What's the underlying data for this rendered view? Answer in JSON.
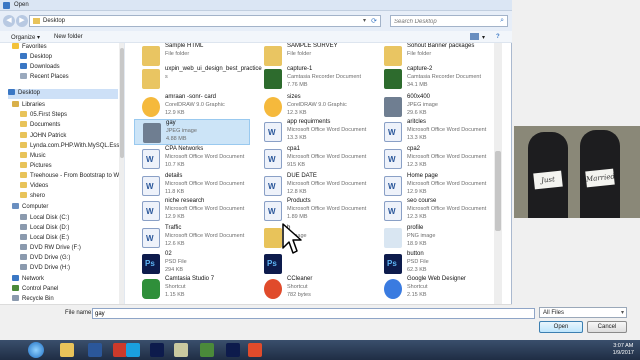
{
  "window": {
    "title": "Open"
  },
  "address": {
    "breadcrumb": "Desktop",
    "search_placeholder": "Search Desktop"
  },
  "toolbar": {
    "organize": "Organize ▾",
    "new_folder": "New folder"
  },
  "sidebar": {
    "items": [
      {
        "label": "Favorites",
        "icon": "star-icon"
      },
      {
        "label": "Desktop",
        "icon": "desktop-icon"
      },
      {
        "label": "Downloads",
        "icon": "downloads-icon"
      },
      {
        "label": "Recent Places",
        "icon": "recent-icon"
      },
      {
        "label": "Desktop",
        "icon": "desktop-icon",
        "selected": true
      },
      {
        "label": "Libraries",
        "icon": "libraries-icon"
      },
      {
        "label": "05.First Steps",
        "icon": "folder-icon"
      },
      {
        "label": "Documents",
        "icon": "documents-icon"
      },
      {
        "label": "JOHN Patrick",
        "icon": "folder-icon"
      },
      {
        "label": "Lynda.com.PHP.With.MySQL.Essent",
        "icon": "folder-icon"
      },
      {
        "label": "Music",
        "icon": "music-icon"
      },
      {
        "label": "Pictures",
        "icon": "pictures-icon"
      },
      {
        "label": "Treehouse - From Bootstrap to Word",
        "icon": "folder-icon"
      },
      {
        "label": "Videos",
        "icon": "videos-icon"
      },
      {
        "label": "shero",
        "icon": "user-icon"
      },
      {
        "label": "Computer",
        "icon": "computer-icon"
      },
      {
        "label": "Local Disk (C:)",
        "icon": "drive-icon"
      },
      {
        "label": "Local Disk (D:)",
        "icon": "drive-icon"
      },
      {
        "label": "Local Disk (E:)",
        "icon": "drive-icon"
      },
      {
        "label": "DVD RW Drive (F:)",
        "icon": "dvd-icon"
      },
      {
        "label": "DVD Drive (G:)",
        "icon": "dvd-icon"
      },
      {
        "label": "DVD Drive (H:)",
        "icon": "dvd-icon"
      },
      {
        "label": "Network",
        "icon": "network-icon"
      },
      {
        "label": "Control Panel",
        "icon": "control-panel-icon"
      },
      {
        "label": "Recycle Bin",
        "icon": "recycle-bin-icon"
      }
    ]
  },
  "files": [
    {
      "name": "Sample HTML",
      "type": "File folder",
      "size": "",
      "icon": "folder"
    },
    {
      "name": "SAMPLE SURVEY",
      "type": "File folder",
      "size": "",
      "icon": "folder"
    },
    {
      "name": "Sohout Banner packages",
      "type": "File folder",
      "size": "",
      "icon": "folder"
    },
    {
      "name": "uxpin_web_ui_design_best_practice",
      "type": "s",
      "size": "",
      "icon": "folder"
    },
    {
      "name": "capture-1",
      "type": "Camtasia Recorder Document",
      "size": "7.76 MB",
      "icon": "cam"
    },
    {
      "name": "capture-2",
      "type": "Camtasia Recorder Document",
      "size": "34.1 MB",
      "icon": "cam"
    },
    {
      "name": "amraan -sonr- card",
      "type": "CorelDRAW 9.0 Graphic",
      "size": "12.9 KB",
      "icon": "cdr"
    },
    {
      "name": "sizes",
      "type": "CorelDRAW 9.0 Graphic",
      "size": "12.3 KB",
      "icon": "cdr"
    },
    {
      "name": "600x400",
      "type": "JPEG image",
      "size": "29.6 KB",
      "icon": "img"
    },
    {
      "name": "gay",
      "type": "JPEG image",
      "size": "4.88 MB",
      "icon": "img",
      "selected": true
    },
    {
      "name": "app requirments",
      "type": "Microsoft Office Word Document",
      "size": "13.3 KB",
      "icon": "doc"
    },
    {
      "name": "aritcles",
      "type": "Microsoft Office Word Document",
      "size": "13.3 KB",
      "icon": "doc"
    },
    {
      "name": "CPA Networks",
      "type": "Microsoft Office Word Document",
      "size": "10.7 KB",
      "icon": "doc"
    },
    {
      "name": "cpa1",
      "type": "Microsoft Office Word Document",
      "size": "915 KB",
      "icon": "doc"
    },
    {
      "name": "cpa2",
      "type": "Microsoft Office Word Document",
      "size": "12.3 KB",
      "icon": "doc"
    },
    {
      "name": "details",
      "type": "Microsoft Office Word Document",
      "size": "11.8 KB",
      "icon": "doc"
    },
    {
      "name": "DUE DATE",
      "type": "Microsoft Office Word Document",
      "size": "12.8 KB",
      "icon": "doc"
    },
    {
      "name": "Home page",
      "type": "Microsoft Office Word Document",
      "size": "12.9 KB",
      "icon": "doc"
    },
    {
      "name": "niche research",
      "type": "Microsoft Office Word Document",
      "size": "12.9 KB",
      "icon": "doc"
    },
    {
      "name": "Products",
      "type": "Microsoft Office Word Document",
      "size": "1.89 MB",
      "icon": "doc"
    },
    {
      "name": "seo course",
      "type": "Microsoft Office Word Document",
      "size": "12.3 KB",
      "icon": "doc"
    },
    {
      "name": "Traffic",
      "type": "Microsoft Office Word Document",
      "size": "12.6 KB",
      "icon": "doc"
    },
    {
      "name": "b",
      "type": "...image",
      "size": "",
      "icon": "png",
      "hover": true
    },
    {
      "name": "profile",
      "type": "PNG image",
      "size": "18.9 KB",
      "icon": "png"
    },
    {
      "name": "02",
      "type": "PSD File",
      "size": "294 KB",
      "icon": "psd"
    },
    {
      "name": "",
      "type": "",
      "size": "",
      "icon": "psd"
    },
    {
      "name": "button",
      "type": "PSD File",
      "size": "62.3 KB",
      "icon": "psd"
    },
    {
      "name": "Camtasia Studio 7",
      "type": "Shortcut",
      "size": "1.15 KB",
      "icon": "shortcut"
    },
    {
      "name": "CCleaner",
      "type": "Shortcut",
      "size": "782 bytes",
      "icon": "cc"
    },
    {
      "name": "Google Web Designer",
      "type": "Shortcut",
      "size": "2.15 KB",
      "icon": "gwd"
    }
  ],
  "bottom": {
    "file_name_label": "File name:",
    "file_name_value": "gay",
    "filter_value": "All Files",
    "open_label": "Open",
    "cancel_label": "Cancel"
  },
  "photo": {
    "sign_left": "Just",
    "sign_right": "Married"
  },
  "taskbar": {
    "time": "3:07 AM",
    "date": "1/9/2017"
  },
  "colors": {
    "selection": "#cce4f7",
    "accent": "#3a77c4",
    "taskbar": "#1f2d44"
  }
}
